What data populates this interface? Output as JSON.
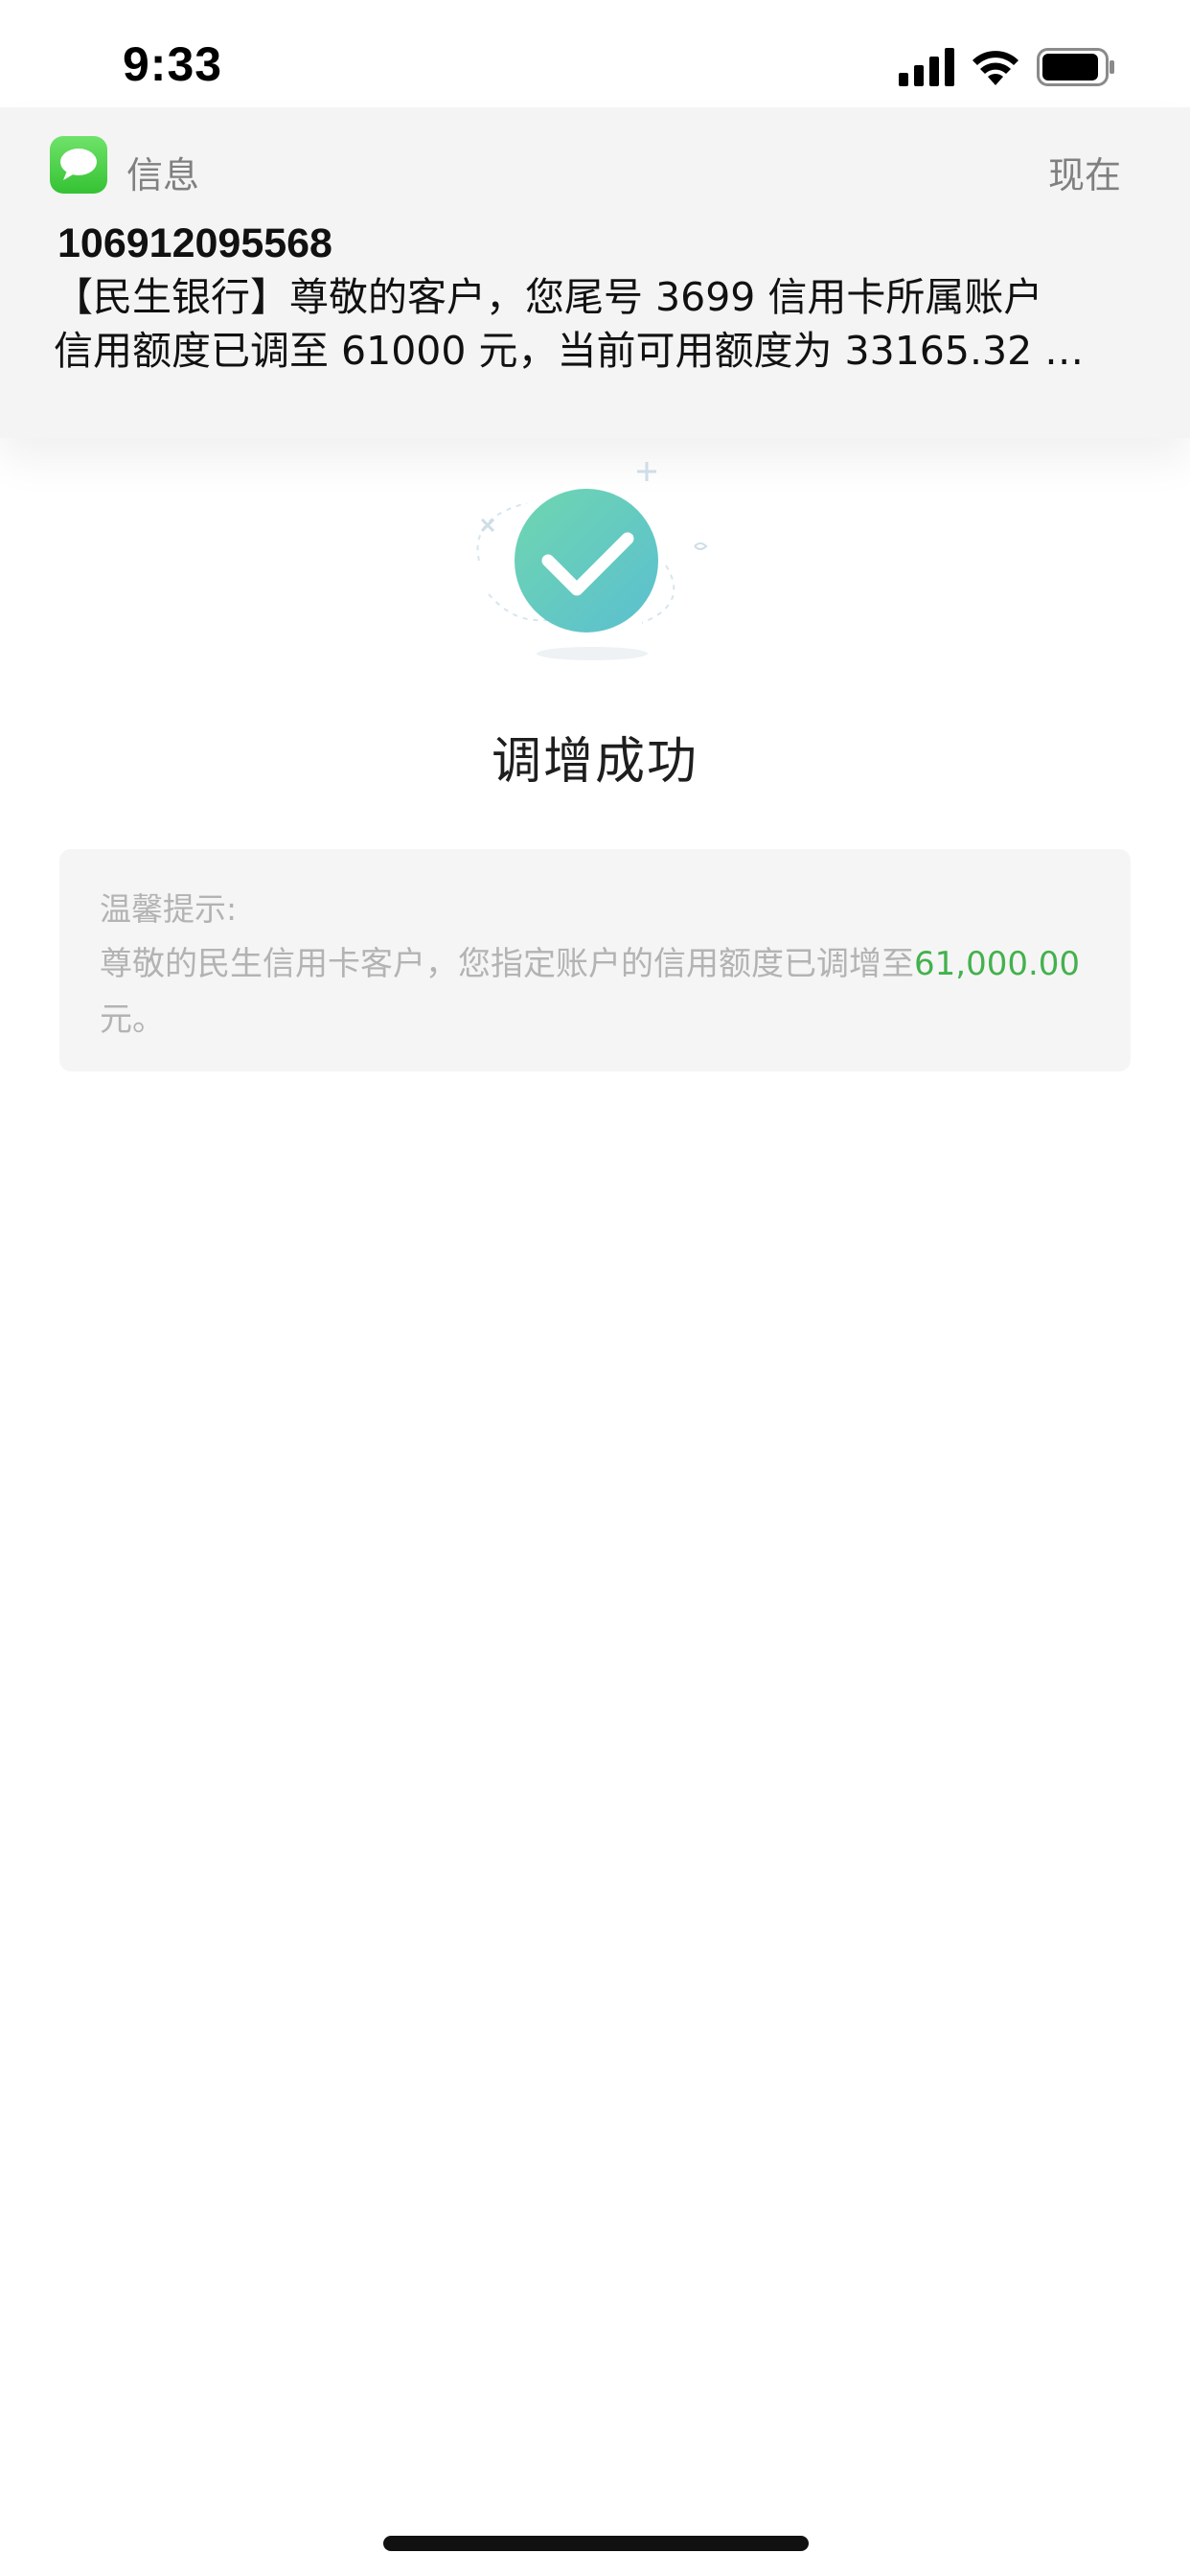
{
  "status_bar": {
    "time": "9:33"
  },
  "notification": {
    "app_name": "信息",
    "time": "现在",
    "sender": "106912095568",
    "body_line1": "【民生银行】尊敬的客户，您尾号 3699 信用卡所属账户",
    "body_line2": "信用额度已调至 61000 元，当前可用额度为 33165.32 …"
  },
  "result": {
    "title": "调增成功"
  },
  "tip": {
    "heading": "温馨提示:",
    "text_prefix": "尊敬的民生信用卡客户，您指定账户的信用额度已调增至",
    "amount": "61,000.00",
    "text_suffix": "元。",
    "amount_color": "#43b14d"
  },
  "icons": {
    "app": "messages-icon",
    "success": "checkmark-icon"
  }
}
